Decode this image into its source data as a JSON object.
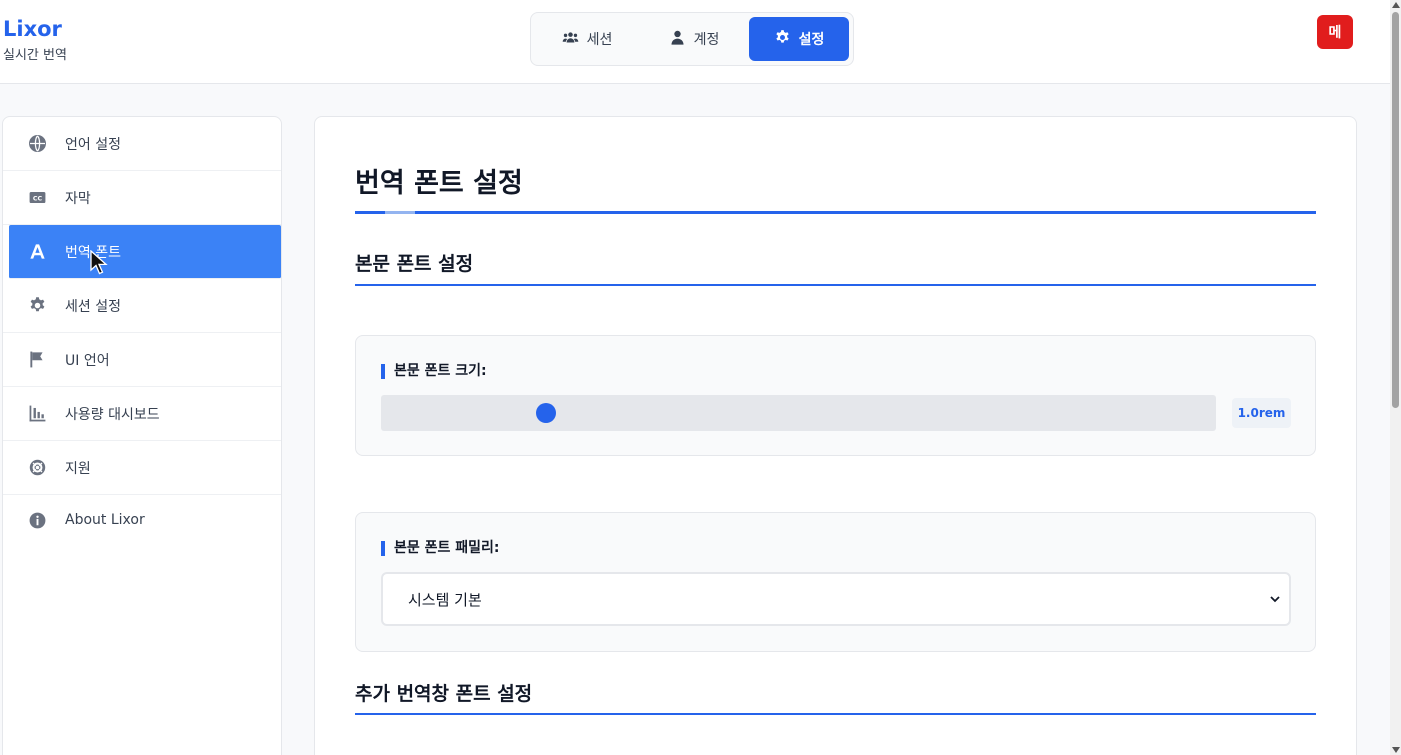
{
  "brand": {
    "name": "Lixor",
    "subtitle": "실시간 번역"
  },
  "top_nav": {
    "tabs": [
      {
        "label": "세션",
        "icon": "users-icon"
      },
      {
        "label": "계정",
        "icon": "user-icon"
      },
      {
        "label": "설정",
        "icon": "gear-icon",
        "active": true
      }
    ]
  },
  "avatar": {
    "label": "메",
    "color": "#e11d1d"
  },
  "sidebar": {
    "items": [
      {
        "label": "언어 설정",
        "icon": "globe-icon"
      },
      {
        "label": "자막",
        "icon": "closed-caption-icon"
      },
      {
        "label": "번역 폰트",
        "icon": "font-icon",
        "active": true
      },
      {
        "label": "세션 설정",
        "icon": "gear-icon"
      },
      {
        "label": "UI 언어",
        "icon": "flag-icon"
      },
      {
        "label": "사용량 대시보드",
        "icon": "bar-chart-icon"
      },
      {
        "label": "지원",
        "icon": "lifebuoy-icon"
      },
      {
        "label": "About Lixor",
        "icon": "info-icon"
      }
    ]
  },
  "main": {
    "title": "번역 폰트 설정",
    "body_section": {
      "title": "본문 폰트 설정",
      "size_label": "본문 폰트 크기:",
      "size_value": "1.0rem",
      "size_slider_fraction": 0.19,
      "family_label": "본문 폰트 패밀리:",
      "family_value": "시스템 기본"
    },
    "extra_section": {
      "title": "추가 번역창 폰트 설정"
    }
  },
  "colors": {
    "accent": "#2563eb",
    "active_sidebar": "#3b82f6"
  }
}
